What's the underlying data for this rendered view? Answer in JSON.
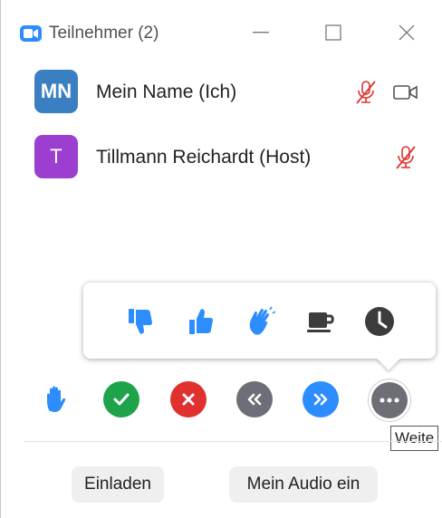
{
  "window": {
    "title": "Teilnehmer (2)"
  },
  "participants": [
    {
      "initials": "MN",
      "name": "Mein Name (Ich)",
      "avatar_color": "#3a7fc2",
      "audio": "muted",
      "video": "off"
    },
    {
      "initials": "T",
      "name": "Tillmann Reichardt (Host)",
      "avatar_color": "#9c3fd1",
      "audio": "muted"
    }
  ],
  "reactions": [
    "thumbs-down-icon",
    "thumbs-up-icon",
    "clapping-hands-icon",
    "coffee-cup-icon",
    "clock-icon"
  ],
  "actions": [
    "raise-hand",
    "yes",
    "no",
    "slower",
    "faster",
    "more"
  ],
  "tooltip": "Weite",
  "footer": {
    "invite_label": "Einladen",
    "audio_label": "Mein Audio ein"
  },
  "colors": {
    "accent": "#2d8cff",
    "green": "#1fa34a",
    "red": "#e0312f",
    "gray": "#6e6e78",
    "muted_red": "#e0312f"
  }
}
